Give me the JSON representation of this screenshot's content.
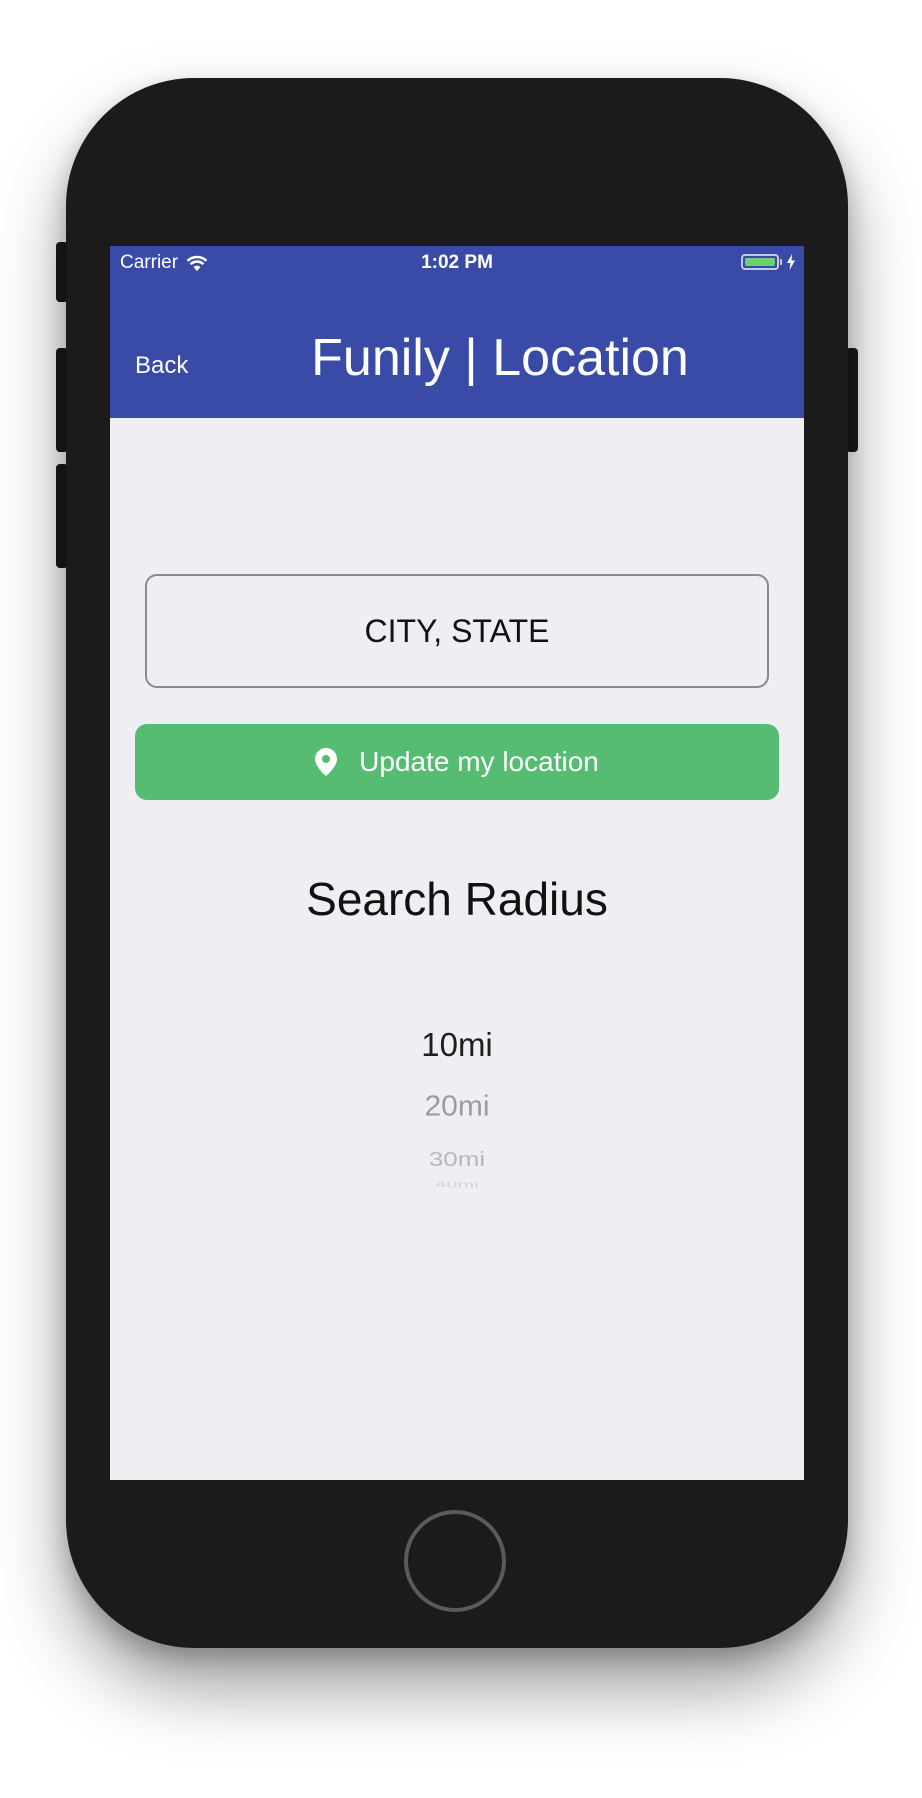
{
  "status_bar": {
    "carrier": "Carrier",
    "time": "1:02 PM",
    "battery_color": "#6ad36c"
  },
  "nav": {
    "back_label": "Back",
    "title": "Funily | Location",
    "background_color": "#3a4ba7"
  },
  "location": {
    "placeholder": "CITY, STATE",
    "value": "",
    "update_button_label": "Update my location",
    "update_button_icon": "location-pin-icon",
    "update_button_color": "#55bc71"
  },
  "search_radius": {
    "heading": "Search Radius",
    "options": [
      "10mi",
      "20mi",
      "30mi",
      "40mi"
    ],
    "selected": "10mi"
  }
}
